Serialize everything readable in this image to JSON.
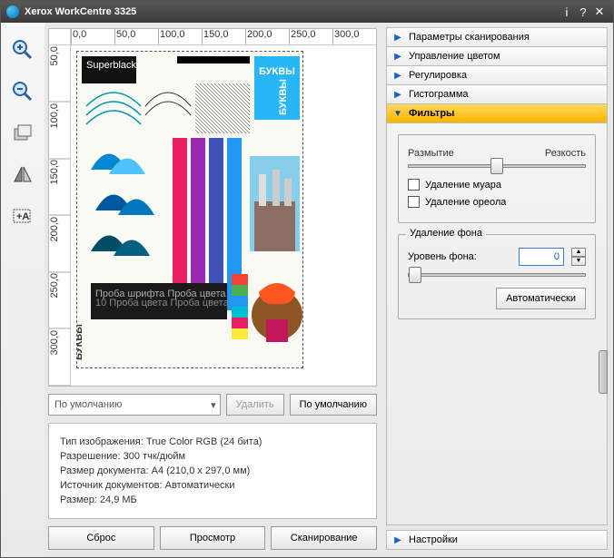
{
  "title": "Xerox WorkCentre 3325",
  "ruler_h": [
    "0,0",
    "50,0",
    "100,0",
    "150,0",
    "200,0",
    "250,0",
    "300,0"
  ],
  "ruler_v": [
    "50,0",
    "100,0",
    "150,0",
    "200,0",
    "250,0",
    "300,0"
  ],
  "preset_combo": "По умолчанию",
  "delete_btn": "Удалить",
  "default_btn": "По умолчанию",
  "info": {
    "image_type": "Тип изображения: True Color RGB (24 бита)",
    "resolution": "Разрешение: 300 тчк/дюйм",
    "doc_size": "Размер документа: A4 (210,0 x 297,0 мм)",
    "source": "Источник документов: Автоматически",
    "size": "Размер: 24,9 МБ"
  },
  "actions": {
    "reset": "Сброс",
    "preview": "Просмотр",
    "scan": "Сканирование"
  },
  "accordion": {
    "scan_params": "Параметры сканирования",
    "color_mgmt": "Управление цветом",
    "adjust": "Регулировка",
    "histogram": "Гистограмма",
    "filters": "Фильтры",
    "settings": "Настройки"
  },
  "filters": {
    "blur": "Размытие",
    "sharp": "Резкость",
    "demoire": "Удаление муара",
    "dehalo": "Удаление ореола",
    "bg_removal": "Удаление фона",
    "bg_level": "Уровень фона:",
    "bg_value": "0",
    "auto": "Автоматически"
  }
}
